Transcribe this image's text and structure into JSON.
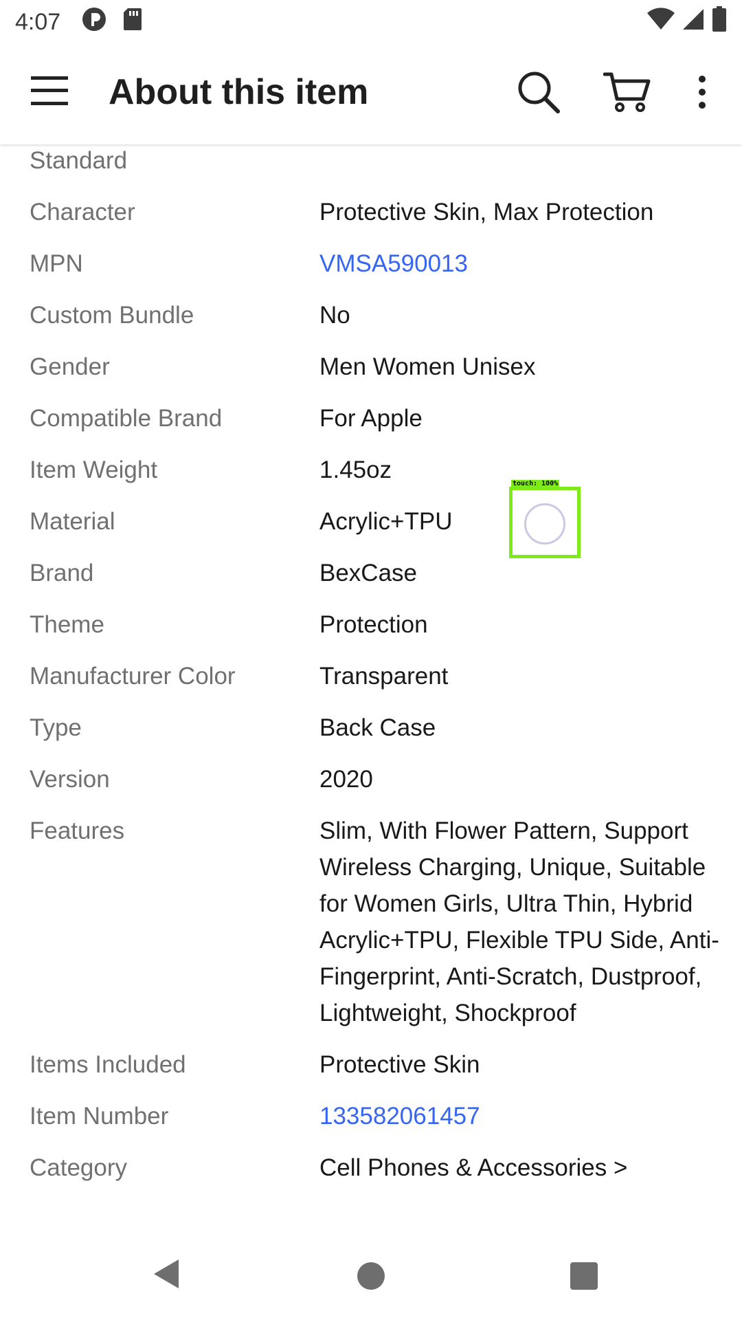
{
  "status_bar": {
    "time": "4:07"
  },
  "app_bar": {
    "title": "About this item",
    "icons": [
      "menu-icon",
      "search-icon",
      "cart-icon",
      "more-vert-icon"
    ]
  },
  "specs": [
    {
      "label": "Standard",
      "value": "",
      "link": false
    },
    {
      "label": "Character",
      "value": "Protective Skin, Max Protection",
      "link": false
    },
    {
      "label": "MPN",
      "value": "VMSA590013",
      "link": true
    },
    {
      "label": "Custom Bundle",
      "value": "No",
      "link": false
    },
    {
      "label": "Gender",
      "value": "Men Women Unisex",
      "link": false
    },
    {
      "label": "Compatible Brand",
      "value": "For Apple",
      "link": false
    },
    {
      "label": "Item Weight",
      "value": "1.45oz",
      "link": false
    },
    {
      "label": "Material",
      "value": "Acrylic+TPU",
      "link": false
    },
    {
      "label": "Brand",
      "value": "BexCase",
      "link": false
    },
    {
      "label": "Theme",
      "value": "Protection",
      "link": false
    },
    {
      "label": "Manufacturer Color",
      "value": "Transparent",
      "link": false
    },
    {
      "label": "Type",
      "value": "Back Case",
      "link": false
    },
    {
      "label": "Version",
      "value": "2020",
      "link": false
    },
    {
      "label": "Features",
      "value": "Slim, With Flower Pattern, Support Wireless Charging, Unique, Suitable for Women Girls, Ultra Thin, Hybrid Acrylic+TPU, Flexible TPU Side, Anti-Fingerprint, Anti-Scratch, Dustproof, Lightweight, Shockproof",
      "link": false
    },
    {
      "label": "Items Included",
      "value": "Protective Skin",
      "link": false
    },
    {
      "label": "Item Number",
      "value": "133582061457",
      "link": true
    },
    {
      "label": "Category",
      "value": "Cell Phones & Accessories >",
      "link": false
    }
  ],
  "touch_indicator": {
    "label": "touch: 100%"
  },
  "colors": {
    "link": "#3665f3",
    "label": "#707070",
    "text": "#191919",
    "touch_box": "#7fea1a"
  }
}
